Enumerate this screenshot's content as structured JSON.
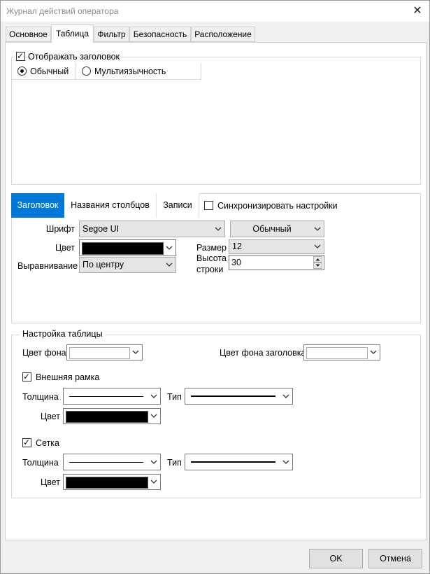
{
  "window": {
    "title": "Журнал действий оператора",
    "close_label": "✕"
  },
  "tabs": [
    {
      "label": "Основное",
      "active": false
    },
    {
      "label": "Таблица",
      "active": true
    },
    {
      "label": "Фильтр",
      "active": false
    },
    {
      "label": "Безопасность",
      "active": false
    },
    {
      "label": "Расположение",
      "active": false
    }
  ],
  "title_section": {
    "show_title_label": "Отображать заголовок",
    "show_title_checked": true,
    "modes": [
      {
        "label": "Обычный",
        "selected": true
      },
      {
        "label": "Мультиязычность",
        "selected": false
      }
    ]
  },
  "header_tabs": [
    {
      "label": "Заголовок",
      "active": true
    },
    {
      "label": "Названия столбцов",
      "active": false
    },
    {
      "label": "Записи",
      "active": false
    }
  ],
  "sync": {
    "label": "Синхронизировать настройки",
    "checked": false
  },
  "font_settings": {
    "font_label": "Шрифт",
    "font_value": "Segoe UI",
    "style_value": "Обычный",
    "color_label": "Цвет",
    "color_value": "#000000",
    "size_label": "Размер",
    "size_value": "12",
    "align_label": "Выравнивание",
    "align_value": "По центру",
    "row_height_label_1": "Высота",
    "row_height_label_2": "строки",
    "row_height_value": "30"
  },
  "table_settings": {
    "section_label": "Настройка таблицы",
    "bg_color_label": "Цвет фона",
    "bg_color_value": "#ffffff",
    "header_bg_label": "Цвет фона заголовка",
    "header_bg_value": "#ffffff",
    "outer_border": {
      "label": "Внешняя рамка",
      "checked": true,
      "thickness_label": "Толщина",
      "type_label": "Тип",
      "color_label": "Цвет",
      "color_value": "#000000"
    },
    "grid": {
      "label": "Сетка",
      "checked": true,
      "thickness_label": "Толщина",
      "type_label": "Тип",
      "color_label": "Цвет",
      "color_value": "#000000"
    }
  },
  "footer": {
    "ok_label": "OK",
    "cancel_label": "Отмена"
  }
}
